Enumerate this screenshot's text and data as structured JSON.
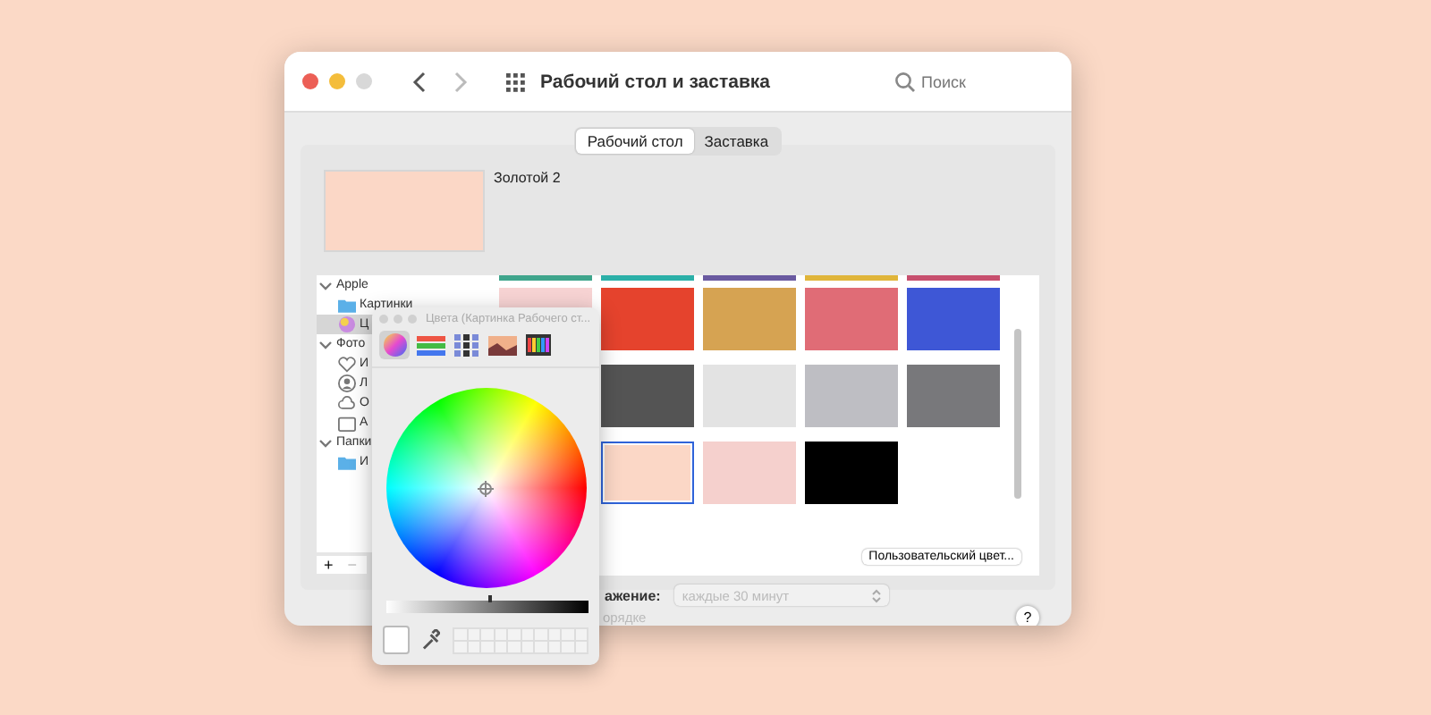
{
  "window": {
    "title": "Рабочий стол и заставка"
  },
  "search": {
    "placeholder": "Поиск"
  },
  "tabs": [
    {
      "label": "Рабочий стол",
      "selected": true
    },
    {
      "label": "Заставка",
      "selected": false
    }
  ],
  "preview": {
    "name": "Золотой 2",
    "color": "#fbd7c6"
  },
  "sidebar": {
    "items": [
      {
        "label": "Apple",
        "expanded": true,
        "selected": false,
        "children": [
          {
            "label": "Картинки",
            "kind": "folder",
            "selected": false
          },
          {
            "label": "Ц",
            "kind": "colors",
            "selected": true
          }
        ]
      },
      {
        "label": "Фото",
        "expanded": true,
        "selected": false,
        "children": [
          {
            "label": "И",
            "kind": "heart",
            "selected": false
          },
          {
            "label": "Л",
            "kind": "person",
            "selected": false
          },
          {
            "label": "О",
            "kind": "cloud",
            "selected": false
          },
          {
            "label": "А",
            "kind": "album",
            "selected": false
          }
        ]
      },
      {
        "label": "Папки",
        "expanded": true,
        "selected": false,
        "children": [
          {
            "label": "И",
            "kind": "folder",
            "selected": false
          }
        ]
      }
    ]
  },
  "top_strips": [
    {
      "color": "#3fa58c"
    },
    {
      "color": "#2bb0a8"
    },
    {
      "color": "#6a5aa0"
    },
    {
      "color": "#e0b53a"
    },
    {
      "color": "#c74f6e"
    }
  ],
  "swatch_rows": [
    [
      {
        "color": "#f7d3d3",
        "selected": false
      },
      {
        "color": "#e5432d",
        "selected": false
      },
      {
        "color": "#d6a352",
        "selected": false
      },
      {
        "color": "#e06c76",
        "selected": false
      },
      {
        "color": "#3e57d6",
        "selected": false
      }
    ],
    [
      {
        "color": "#545454",
        "selected": false
      },
      {
        "color": "#e3e3e3",
        "selected": false
      },
      {
        "color": "#bebec3",
        "selected": false
      },
      {
        "color": "#78787b",
        "selected": false
      }
    ],
    [
      {
        "color": "#fbd7c6",
        "selected": true
      },
      {
        "color": "#f5d0cd",
        "selected": false
      },
      {
        "color": "#000000",
        "selected": false
      }
    ]
  ],
  "custom_color_button": "Пользовательский цвет...",
  "add_button": "+",
  "remove_button": "−",
  "change_label": "ажение:",
  "interval": {
    "value": "каждые 30 минут",
    "disabled": true
  },
  "random_label": "орядке",
  "help_button": "?",
  "color_panel": {
    "title": "Цвета (Картинка Рабочего ст...",
    "modes": [
      {
        "kind": "wheel",
        "selected": true
      },
      {
        "kind": "sliders",
        "selected": false
      },
      {
        "kind": "palettes",
        "selected": false
      },
      {
        "kind": "image",
        "selected": false
      },
      {
        "kind": "pencils",
        "selected": false
      }
    ],
    "brightness": {
      "level": 0.5
    },
    "current": {
      "color": "#ffffff"
    }
  }
}
